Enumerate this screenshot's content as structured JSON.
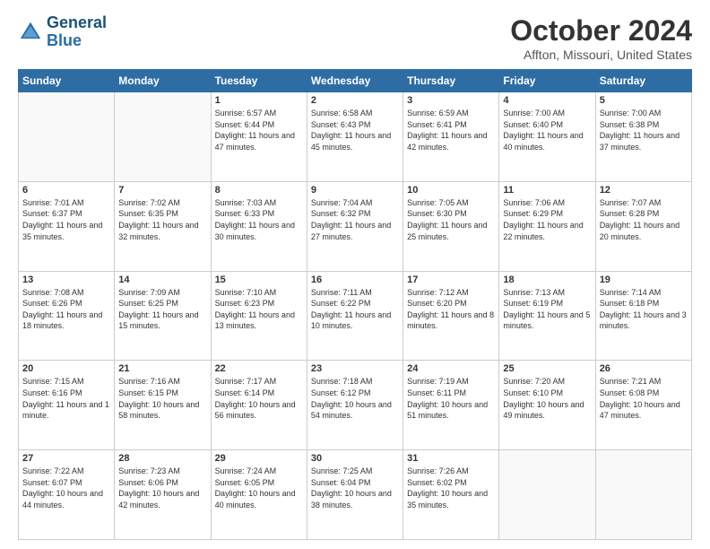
{
  "header": {
    "logo_line1": "General",
    "logo_line2": "Blue",
    "month": "October 2024",
    "location": "Affton, Missouri, United States"
  },
  "weekdays": [
    "Sunday",
    "Monday",
    "Tuesday",
    "Wednesday",
    "Thursday",
    "Friday",
    "Saturday"
  ],
  "weeks": [
    [
      {
        "day": "",
        "sunrise": "",
        "sunset": "",
        "daylight": ""
      },
      {
        "day": "",
        "sunrise": "",
        "sunset": "",
        "daylight": ""
      },
      {
        "day": "1",
        "sunrise": "Sunrise: 6:57 AM",
        "sunset": "Sunset: 6:44 PM",
        "daylight": "Daylight: 11 hours and 47 minutes."
      },
      {
        "day": "2",
        "sunrise": "Sunrise: 6:58 AM",
        "sunset": "Sunset: 6:43 PM",
        "daylight": "Daylight: 11 hours and 45 minutes."
      },
      {
        "day": "3",
        "sunrise": "Sunrise: 6:59 AM",
        "sunset": "Sunset: 6:41 PM",
        "daylight": "Daylight: 11 hours and 42 minutes."
      },
      {
        "day": "4",
        "sunrise": "Sunrise: 7:00 AM",
        "sunset": "Sunset: 6:40 PM",
        "daylight": "Daylight: 11 hours and 40 minutes."
      },
      {
        "day": "5",
        "sunrise": "Sunrise: 7:00 AM",
        "sunset": "Sunset: 6:38 PM",
        "daylight": "Daylight: 11 hours and 37 minutes."
      }
    ],
    [
      {
        "day": "6",
        "sunrise": "Sunrise: 7:01 AM",
        "sunset": "Sunset: 6:37 PM",
        "daylight": "Daylight: 11 hours and 35 minutes."
      },
      {
        "day": "7",
        "sunrise": "Sunrise: 7:02 AM",
        "sunset": "Sunset: 6:35 PM",
        "daylight": "Daylight: 11 hours and 32 minutes."
      },
      {
        "day": "8",
        "sunrise": "Sunrise: 7:03 AM",
        "sunset": "Sunset: 6:33 PM",
        "daylight": "Daylight: 11 hours and 30 minutes."
      },
      {
        "day": "9",
        "sunrise": "Sunrise: 7:04 AM",
        "sunset": "Sunset: 6:32 PM",
        "daylight": "Daylight: 11 hours and 27 minutes."
      },
      {
        "day": "10",
        "sunrise": "Sunrise: 7:05 AM",
        "sunset": "Sunset: 6:30 PM",
        "daylight": "Daylight: 11 hours and 25 minutes."
      },
      {
        "day": "11",
        "sunrise": "Sunrise: 7:06 AM",
        "sunset": "Sunset: 6:29 PM",
        "daylight": "Daylight: 11 hours and 22 minutes."
      },
      {
        "day": "12",
        "sunrise": "Sunrise: 7:07 AM",
        "sunset": "Sunset: 6:28 PM",
        "daylight": "Daylight: 11 hours and 20 minutes."
      }
    ],
    [
      {
        "day": "13",
        "sunrise": "Sunrise: 7:08 AM",
        "sunset": "Sunset: 6:26 PM",
        "daylight": "Daylight: 11 hours and 18 minutes."
      },
      {
        "day": "14",
        "sunrise": "Sunrise: 7:09 AM",
        "sunset": "Sunset: 6:25 PM",
        "daylight": "Daylight: 11 hours and 15 minutes."
      },
      {
        "day": "15",
        "sunrise": "Sunrise: 7:10 AM",
        "sunset": "Sunset: 6:23 PM",
        "daylight": "Daylight: 11 hours and 13 minutes."
      },
      {
        "day": "16",
        "sunrise": "Sunrise: 7:11 AM",
        "sunset": "Sunset: 6:22 PM",
        "daylight": "Daylight: 11 hours and 10 minutes."
      },
      {
        "day": "17",
        "sunrise": "Sunrise: 7:12 AM",
        "sunset": "Sunset: 6:20 PM",
        "daylight": "Daylight: 11 hours and 8 minutes."
      },
      {
        "day": "18",
        "sunrise": "Sunrise: 7:13 AM",
        "sunset": "Sunset: 6:19 PM",
        "daylight": "Daylight: 11 hours and 5 minutes."
      },
      {
        "day": "19",
        "sunrise": "Sunrise: 7:14 AM",
        "sunset": "Sunset: 6:18 PM",
        "daylight": "Daylight: 11 hours and 3 minutes."
      }
    ],
    [
      {
        "day": "20",
        "sunrise": "Sunrise: 7:15 AM",
        "sunset": "Sunset: 6:16 PM",
        "daylight": "Daylight: 11 hours and 1 minute."
      },
      {
        "day": "21",
        "sunrise": "Sunrise: 7:16 AM",
        "sunset": "Sunset: 6:15 PM",
        "daylight": "Daylight: 10 hours and 58 minutes."
      },
      {
        "day": "22",
        "sunrise": "Sunrise: 7:17 AM",
        "sunset": "Sunset: 6:14 PM",
        "daylight": "Daylight: 10 hours and 56 minutes."
      },
      {
        "day": "23",
        "sunrise": "Sunrise: 7:18 AM",
        "sunset": "Sunset: 6:12 PM",
        "daylight": "Daylight: 10 hours and 54 minutes."
      },
      {
        "day": "24",
        "sunrise": "Sunrise: 7:19 AM",
        "sunset": "Sunset: 6:11 PM",
        "daylight": "Daylight: 10 hours and 51 minutes."
      },
      {
        "day": "25",
        "sunrise": "Sunrise: 7:20 AM",
        "sunset": "Sunset: 6:10 PM",
        "daylight": "Daylight: 10 hours and 49 minutes."
      },
      {
        "day": "26",
        "sunrise": "Sunrise: 7:21 AM",
        "sunset": "Sunset: 6:08 PM",
        "daylight": "Daylight: 10 hours and 47 minutes."
      }
    ],
    [
      {
        "day": "27",
        "sunrise": "Sunrise: 7:22 AM",
        "sunset": "Sunset: 6:07 PM",
        "daylight": "Daylight: 10 hours and 44 minutes."
      },
      {
        "day": "28",
        "sunrise": "Sunrise: 7:23 AM",
        "sunset": "Sunset: 6:06 PM",
        "daylight": "Daylight: 10 hours and 42 minutes."
      },
      {
        "day": "29",
        "sunrise": "Sunrise: 7:24 AM",
        "sunset": "Sunset: 6:05 PM",
        "daylight": "Daylight: 10 hours and 40 minutes."
      },
      {
        "day": "30",
        "sunrise": "Sunrise: 7:25 AM",
        "sunset": "Sunset: 6:04 PM",
        "daylight": "Daylight: 10 hours and 38 minutes."
      },
      {
        "day": "31",
        "sunrise": "Sunrise: 7:26 AM",
        "sunset": "Sunset: 6:02 PM",
        "daylight": "Daylight: 10 hours and 35 minutes."
      },
      {
        "day": "",
        "sunrise": "",
        "sunset": "",
        "daylight": ""
      },
      {
        "day": "",
        "sunrise": "",
        "sunset": "",
        "daylight": ""
      }
    ]
  ]
}
